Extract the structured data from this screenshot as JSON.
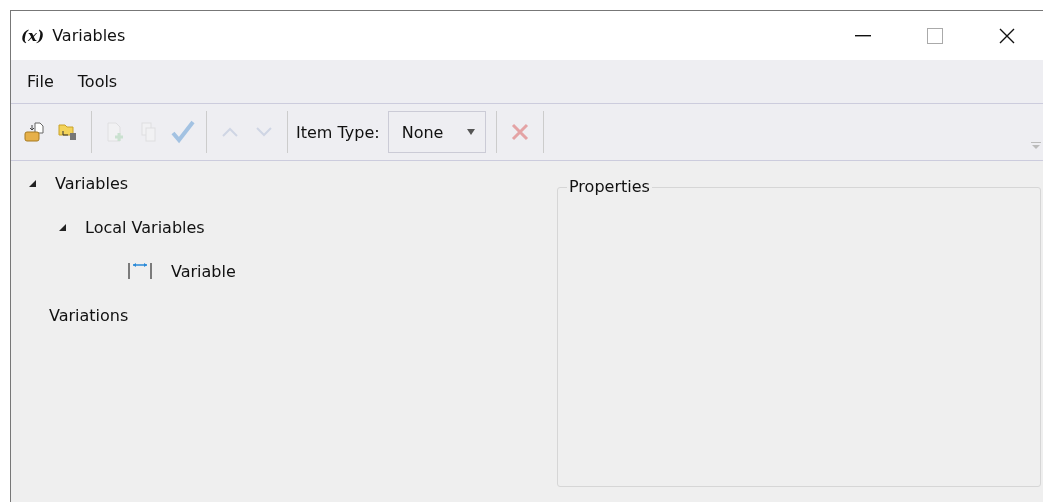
{
  "window": {
    "title": "Variables",
    "icon": "(x)"
  },
  "menu": [
    "File",
    "Tools"
  ],
  "toolbar": [
    {
      "kind": "open",
      "disabled": false
    },
    {
      "kind": "import",
      "disabled": false
    },
    {
      "kind": "sep"
    },
    {
      "kind": "add",
      "disabled": true
    },
    {
      "kind": "copy",
      "disabled": true
    },
    {
      "kind": "check",
      "disabled": true
    },
    {
      "kind": "sep"
    },
    {
      "kind": "up",
      "disabled": true
    },
    {
      "kind": "down",
      "disabled": true
    },
    {
      "kind": "sep"
    },
    {
      "kind": "label",
      "text": "Item Type:"
    },
    {
      "kind": "combo",
      "value": "None"
    },
    {
      "kind": "sep"
    },
    {
      "kind": "delete",
      "disabled": true
    },
    {
      "kind": "sep"
    }
  ],
  "tree": [
    {
      "label": "Variables",
      "expanded": true,
      "children": [
        {
          "label": "Local Variables",
          "expanded": true,
          "children": [
            {
              "label": "Variable",
              "kind": "variable"
            }
          ]
        }
      ]
    },
    {
      "label": "Variations"
    }
  ],
  "properties": {
    "title": "Properties"
  }
}
